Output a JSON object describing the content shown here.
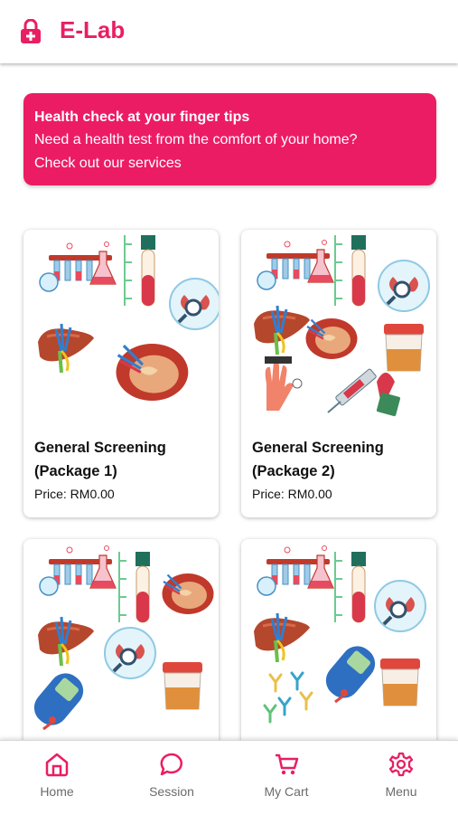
{
  "app": {
    "title": "E-Lab",
    "accent": "#e91e63",
    "logo_icon": "lock-plus-icon"
  },
  "banner": {
    "title": "Health check at your finger tips",
    "line1": "Need a health test from the comfort of your home?",
    "line2": "Check out our services"
  },
  "packages": [
    {
      "name": "General Screening (Package 1)",
      "price": "Price: RM0.00"
    },
    {
      "name": "General Screening (Package 2)",
      "price": "Price: RM0.00"
    },
    {
      "name": "",
      "price": ""
    },
    {
      "name": "",
      "price": ""
    }
  ],
  "nav": [
    {
      "label": "Home",
      "icon": "home-icon"
    },
    {
      "label": "Session",
      "icon": "chat-bubble-icon"
    },
    {
      "label": "My Cart",
      "icon": "cart-icon"
    },
    {
      "label": "Menu",
      "icon": "gear-icon"
    }
  ]
}
